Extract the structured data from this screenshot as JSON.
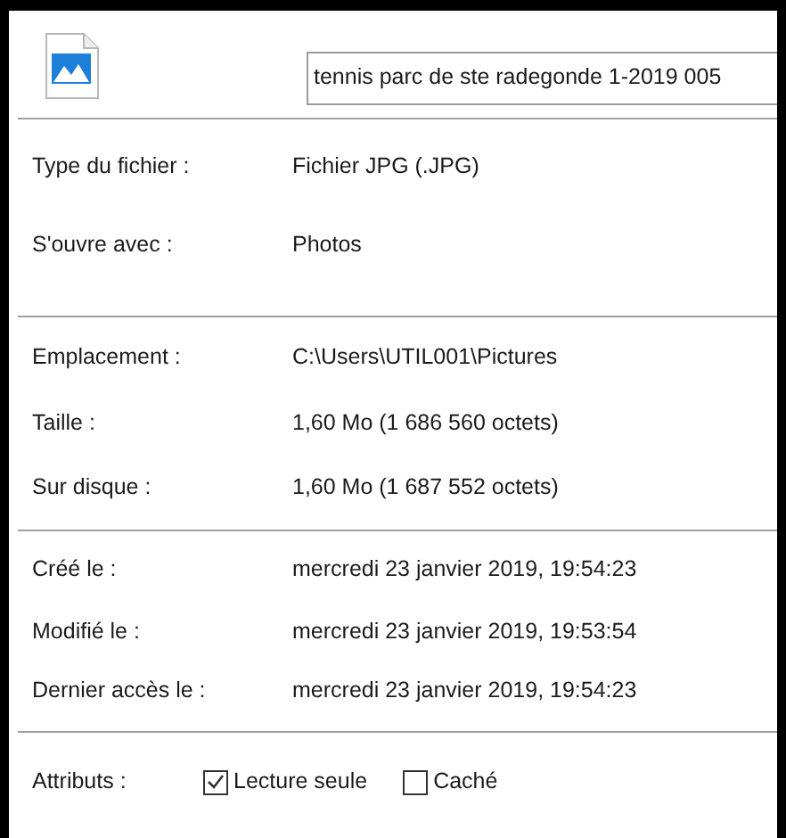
{
  "file_name": "tennis parc de ste radegonde 1-2019 005",
  "sections": [
    {
      "rows": [
        {
          "label": "Type du fichier :",
          "value": "Fichier JPG (.JPG)"
        },
        {
          "label": "S'ouvre avec :",
          "value": "Photos"
        }
      ]
    },
    {
      "rows": [
        {
          "label": "Emplacement :",
          "value": "C:\\Users\\UTIL001\\Pictures"
        },
        {
          "label": "Taille :",
          "value": "1,60 Mo (1 686 560 octets)"
        },
        {
          "label": "Sur disque :",
          "value": "1,60 Mo (1 687 552 octets)"
        }
      ]
    },
    {
      "rows": [
        {
          "label": "Créé le :",
          "value": "mercredi 23 janvier 2019, 19:54:23"
        },
        {
          "label": "Modifié le :",
          "value": "mercredi 23 janvier 2019, 19:53:54"
        },
        {
          "label": "Dernier accès le :",
          "value": "mercredi 23 janvier 2019, 19:54:23"
        }
      ]
    }
  ],
  "attributes": {
    "label": "Attributs :",
    "options": [
      {
        "label": "Lecture seule",
        "checked": true
      },
      {
        "label": "Caché",
        "checked": false
      }
    ]
  }
}
